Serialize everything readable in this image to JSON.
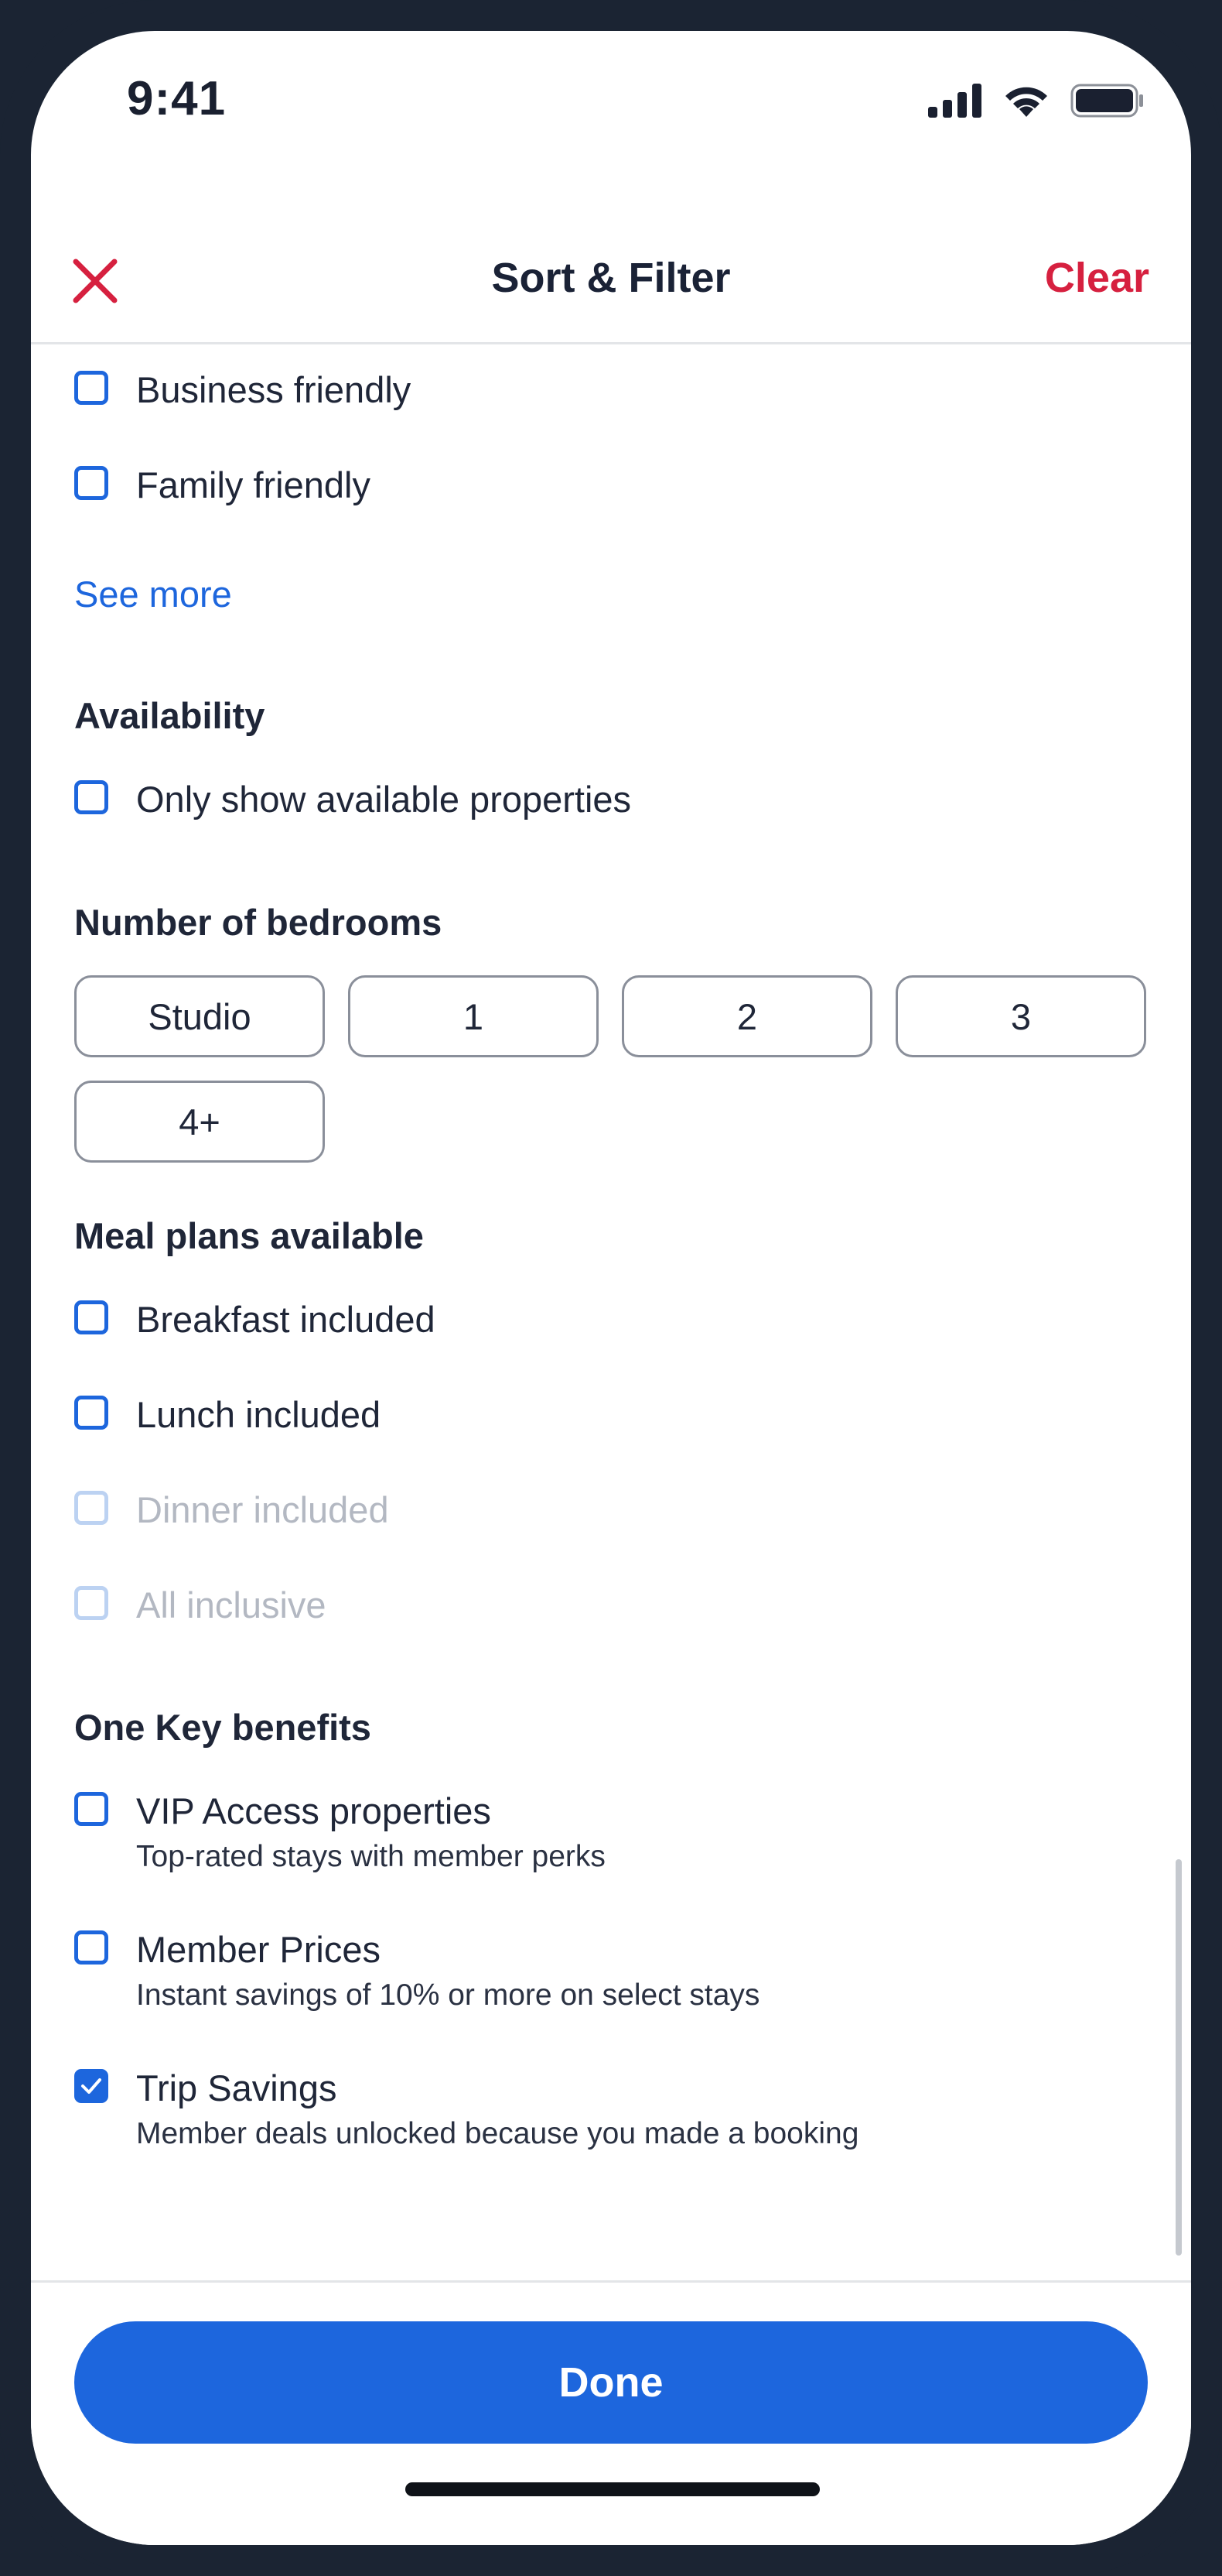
{
  "status_bar": {
    "time": "9:41",
    "icons": [
      "cellular-signal-icon",
      "wifi-icon",
      "battery-icon"
    ]
  },
  "header": {
    "close_icon": "close-icon",
    "title": "Sort & Filter",
    "clear_label": "Clear"
  },
  "property_type_partial": {
    "options": [
      {
        "label": "Business friendly",
        "checked": false,
        "disabled": false
      },
      {
        "label": "Family friendly",
        "checked": false,
        "disabled": false
      }
    ],
    "see_more": "See more"
  },
  "availability": {
    "title": "Availability",
    "options": [
      {
        "label": "Only show available properties",
        "checked": false,
        "disabled": false
      }
    ]
  },
  "bedrooms": {
    "title": "Number of bedrooms",
    "chips": [
      "Studio",
      "1",
      "2",
      "3",
      "4+"
    ]
  },
  "meal_plans": {
    "title": "Meal plans available",
    "options": [
      {
        "label": "Breakfast included",
        "checked": false,
        "disabled": false
      },
      {
        "label": "Lunch included",
        "checked": false,
        "disabled": false
      },
      {
        "label": "Dinner included",
        "checked": false,
        "disabled": true
      },
      {
        "label": "All inclusive",
        "checked": false,
        "disabled": true
      }
    ]
  },
  "one_key": {
    "title": "One Key benefits",
    "options": [
      {
        "label": "VIP Access properties",
        "description": "Top-rated stays with member perks",
        "checked": false
      },
      {
        "label": "Member Prices",
        "description": "Instant savings of 10% or more on select stays",
        "checked": false
      },
      {
        "label": "Trip Savings",
        "description": "Member deals unlocked because you made a booking",
        "checked": true
      }
    ]
  },
  "footer": {
    "done_label": "Done"
  },
  "colors": {
    "accent": "#1d66dd",
    "danger": "#d6203f",
    "disabled": "#bcd2f2"
  }
}
